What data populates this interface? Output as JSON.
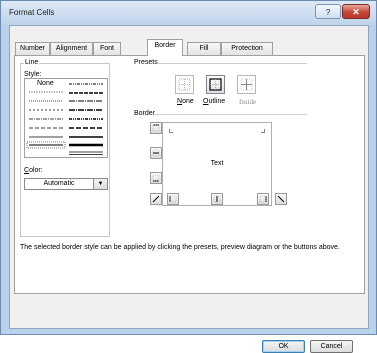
{
  "window": {
    "title": "Format Cells",
    "help_label": "?",
    "close_label": "✕"
  },
  "tabs": [
    {
      "label": "Number",
      "active": false
    },
    {
      "label": "Alignment",
      "active": false
    },
    {
      "label": "Font",
      "active": false
    },
    {
      "label": "Border",
      "active": true
    },
    {
      "label": "Fill",
      "active": false
    },
    {
      "label": "Protection",
      "active": false
    }
  ],
  "line": {
    "heading": "Line",
    "style_label": "Style:",
    "none_label": "None",
    "color_label": "Color:",
    "color_value": "Automatic"
  },
  "presets": {
    "heading": "Presets",
    "items": [
      {
        "label": "None",
        "icon": "border-none-icon",
        "selected": false
      },
      {
        "label": "Outline",
        "icon": "border-outline-icon",
        "selected": true
      },
      {
        "label": "Inside",
        "icon": "border-inside-icon",
        "selected": false
      }
    ]
  },
  "border": {
    "heading": "Border",
    "preview_text": "Text"
  },
  "description": "The selected border style can be applied by clicking the presets, preview diagram or the buttons above.",
  "buttons": {
    "ok": "OK",
    "cancel": "Cancel"
  },
  "colors": {
    "title_bar": "#bed3ea",
    "dialog_face": "#f0f0f0",
    "close_button": "#c6463a",
    "selected_line": "#000000"
  }
}
